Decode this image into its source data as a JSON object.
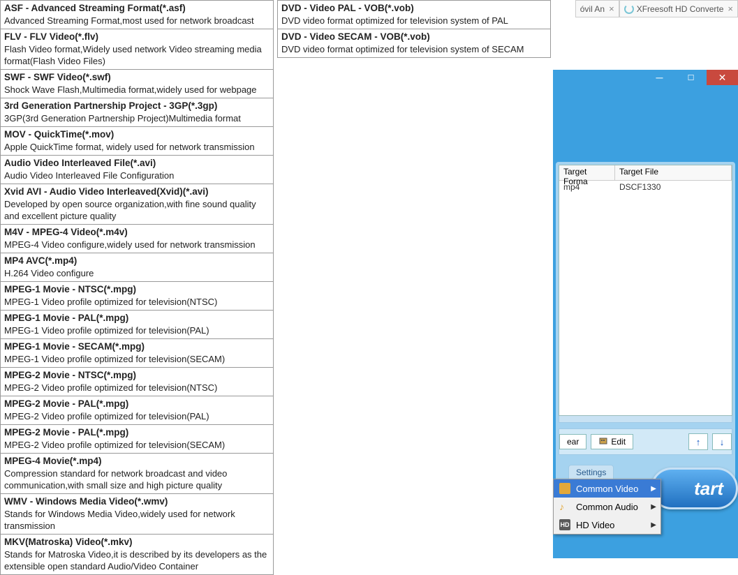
{
  "tabs": [
    {
      "label": "óvil An",
      "close": "×"
    },
    {
      "label": "XFreesoft HD Converte",
      "close": "×"
    }
  ],
  "formats_left": [
    {
      "title": "ASF - Advanced Streaming Format(*.asf)",
      "desc": "Advanced Streaming Format,most used for network broadcast"
    },
    {
      "title": "FLV - FLV Video(*.flv)",
      "desc": "Flash Video format,Widely used network Video streaming media format(Flash Video Files)"
    },
    {
      "title": "SWF - SWF Video(*.swf)",
      "desc": "Shock Wave Flash,Multimedia format,widely used for webpage"
    },
    {
      "title": "3rd Generation Partnership Project - 3GP(*.3gp)",
      "desc": "3GP(3rd Generation Partnership Project)Multimedia format"
    },
    {
      "title": "MOV - QuickTime(*.mov)",
      "desc": "Apple QuickTime format, widely used for network transmission"
    },
    {
      "title": "Audio Video Interleaved File(*.avi)",
      "desc": "Audio Video Interleaved File Configuration"
    },
    {
      "title": "Xvid AVI - Audio Video Interleaved(Xvid)(*.avi)",
      "desc": "Developed by open source organization,with fine sound quality and excellent picture quality"
    },
    {
      "title": "M4V - MPEG-4 Video(*.m4v)",
      "desc": "MPEG-4 Video configure,widely used for network transmission"
    },
    {
      "title": "MP4 AVC(*.mp4)",
      "desc": "H.264 Video configure"
    },
    {
      "title": "MPEG-1 Movie - NTSC(*.mpg)",
      "desc": "MPEG-1 Video profile optimized for television(NTSC)"
    },
    {
      "title": "MPEG-1 Movie - PAL(*.mpg)",
      "desc": "MPEG-1 Video profile optimized for television(PAL)"
    },
    {
      "title": "MPEG-1 Movie - SECAM(*.mpg)",
      "desc": "MPEG-1 Video profile optimized for television(SECAM)"
    },
    {
      "title": "MPEG-2 Movie - NTSC(*.mpg)",
      "desc": "MPEG-2 Video profile optimized for television(NTSC)"
    },
    {
      "title": "MPEG-2 Movie - PAL(*.mpg)",
      "desc": "MPEG-2 Video profile optimized for television(PAL)"
    },
    {
      "title": "MPEG-2 Movie - PAL(*.mpg)",
      "desc": "MPEG-2 Video profile optimized for television(SECAM)"
    },
    {
      "title": "MPEG-4 Movie(*.mp4)",
      "desc": "Compression standard for network broadcast and video communication,with small size and high picture quality"
    },
    {
      "title": "WMV - Windows Media Video(*.wmv)",
      "desc": "Stands for Windows Media Video,widely used for network transmission"
    },
    {
      "title": "MKV(Matroska) Video(*.mkv)",
      "desc": "Stands for Matroska Video,it is described by its developers as the extensible open standard Audio/Video Container"
    }
  ],
  "formats_right": [
    {
      "title": "DVD - Video PAL - VOB(*.vob)",
      "desc": "DVD video format optimized for television system of PAL"
    },
    {
      "title": "DVD - Video SECAM - VOB(*.vob)",
      "desc": "DVD video format optimized for television system of SECAM"
    }
  ],
  "grid": {
    "headers": {
      "target_format": "Target Forma",
      "target_file": "Target File"
    },
    "rows": [
      {
        "format": "mp4",
        "file": "DSCF1330"
      }
    ]
  },
  "toolbar": {
    "clear": "ear",
    "edit": "Edit",
    "up": "↑",
    "down": "↓"
  },
  "settings": {
    "label": "Settings"
  },
  "popup": {
    "items": [
      {
        "label": "Common Video",
        "sel": true
      },
      {
        "label": "Common Audio",
        "sel": false
      },
      {
        "label": "HD Video",
        "sel": false
      }
    ]
  },
  "start": {
    "label": "tart"
  }
}
